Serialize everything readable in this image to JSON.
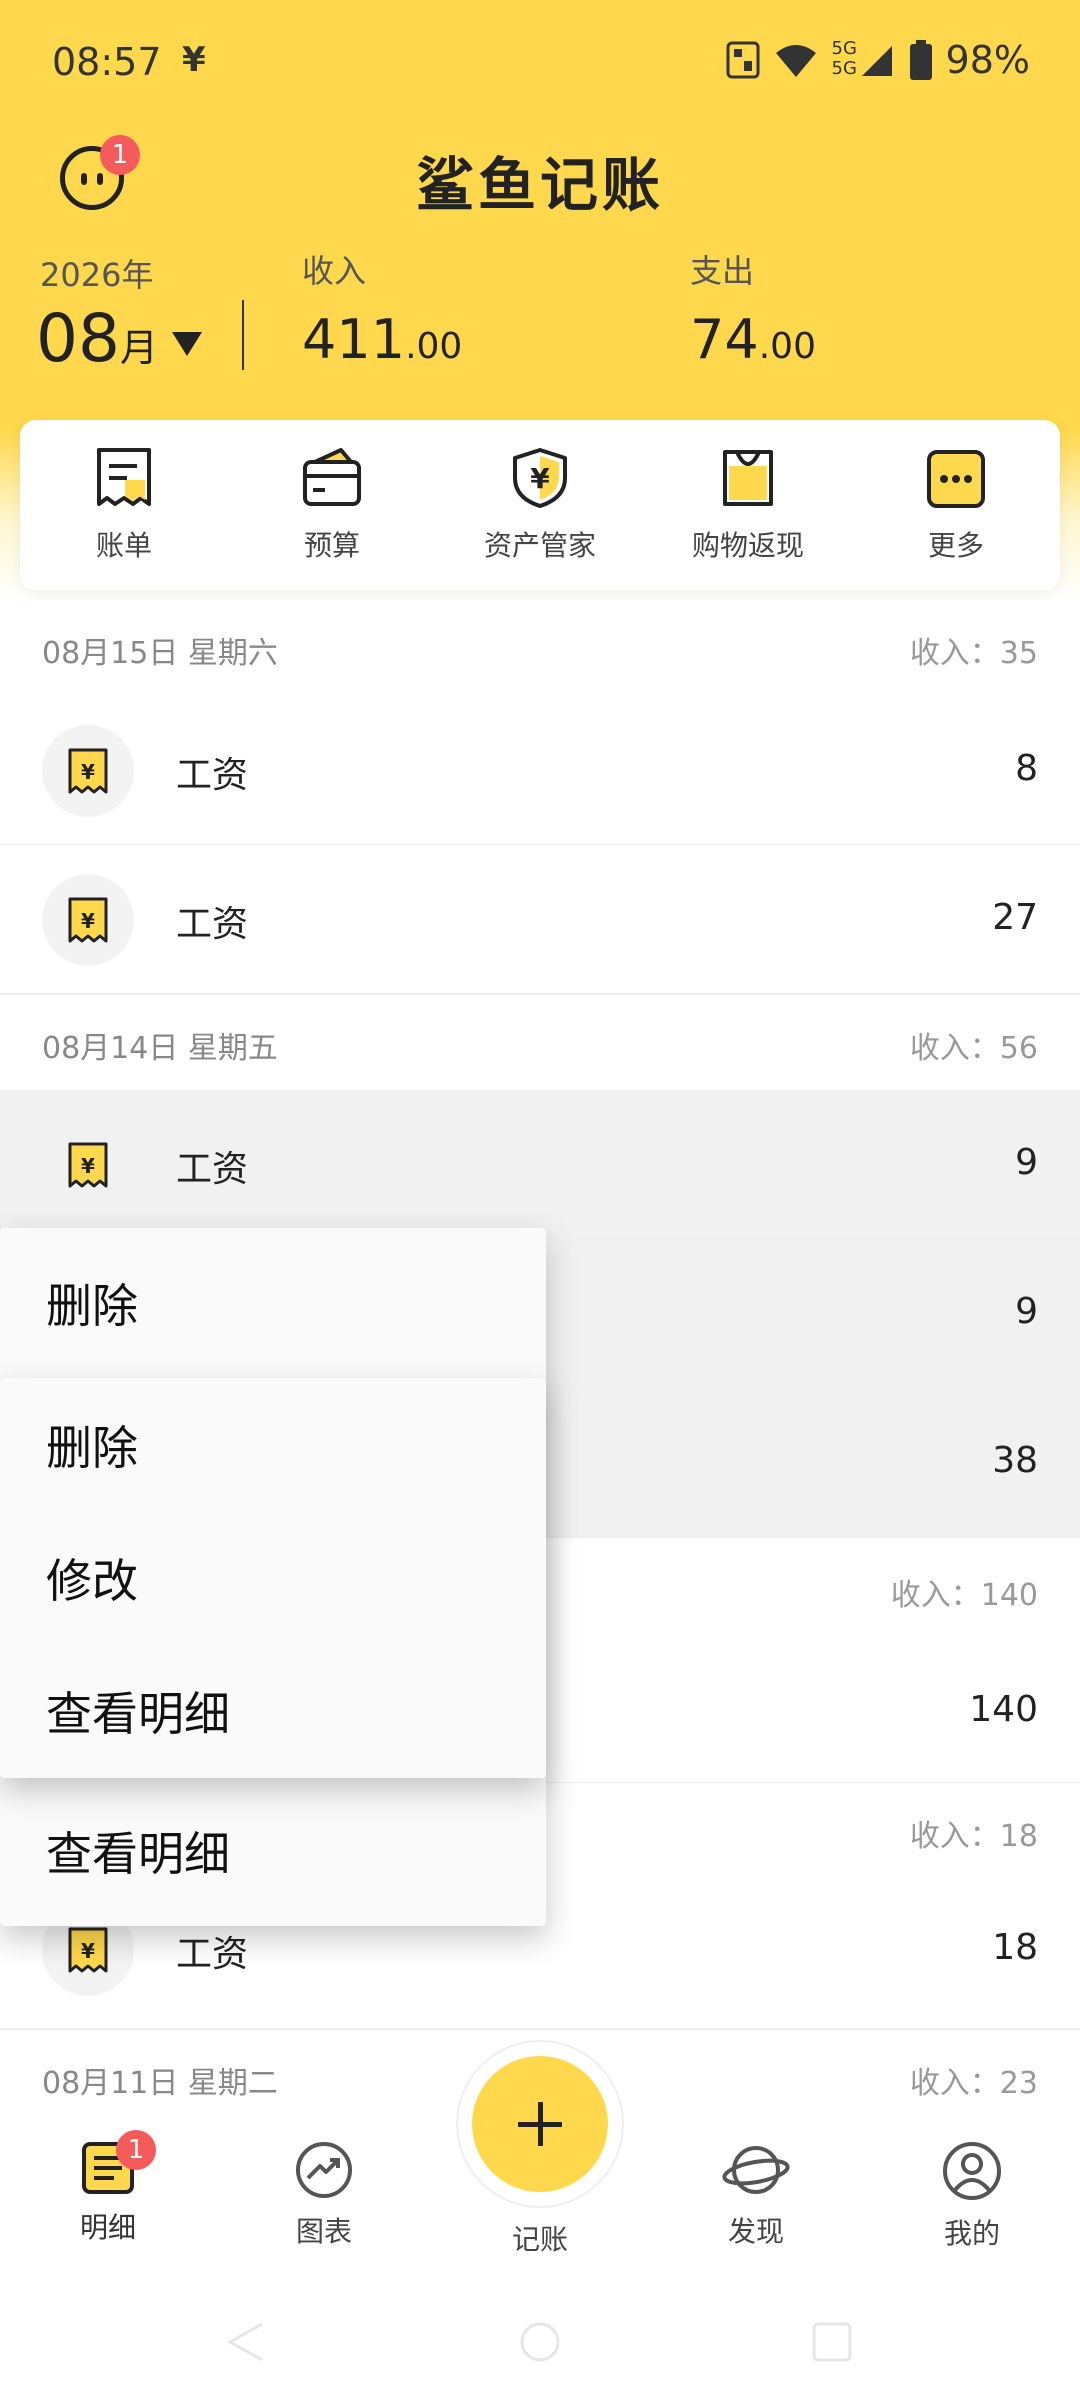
{
  "status": {
    "time": "08:57",
    "yen_glyph": "¥",
    "battery": "98%",
    "network_labels": [
      "5G",
      "5G"
    ]
  },
  "header": {
    "title": "鲨鱼记账",
    "avatar_badge": "1"
  },
  "summary": {
    "year": "2026年",
    "month": "08",
    "month_unit": "月",
    "income_label": "收入",
    "income_int": "411",
    "income_dec": ".00",
    "expense_label": "支出",
    "expense_int": "74",
    "expense_dec": ".00"
  },
  "quick_actions": [
    {
      "label": "账单",
      "icon": "bill-icon"
    },
    {
      "label": "预算",
      "icon": "wallet-icon"
    },
    {
      "label": "资产管家",
      "icon": "shield-yen-icon"
    },
    {
      "label": "购物返现",
      "icon": "shopping-bag-icon"
    },
    {
      "label": "更多",
      "icon": "more-icon"
    }
  ],
  "sections": [
    {
      "date": "08月15日 星期六",
      "summary": "收入：35",
      "rows": [
        {
          "label": "工资",
          "amount": "8"
        },
        {
          "label": "工资",
          "amount": "27"
        }
      ]
    },
    {
      "date": "08月14日 星期五",
      "summary": "收入：56",
      "rows": [
        {
          "label": "工资",
          "amount": "9"
        },
        {
          "label": "",
          "amount": "9"
        },
        {
          "label": "",
          "amount": "38"
        }
      ]
    },
    {
      "date": "",
      "summary": "收入：140",
      "rows": [
        {
          "label": "",
          "amount": "140"
        }
      ]
    },
    {
      "date": "",
      "summary": "收入：18",
      "rows": [
        {
          "label": "工资",
          "amount": "18"
        }
      ]
    },
    {
      "date": "08月11日 星期二",
      "summary": "收入：23",
      "rows": []
    }
  ],
  "context_menu_back": {
    "items": [
      "删除",
      "查看明细"
    ]
  },
  "context_menu_front": {
    "items": [
      "删除",
      "修改",
      "查看明细"
    ]
  },
  "bottom_nav": {
    "items": [
      {
        "label": "明细",
        "icon": "list-icon",
        "badge": "1"
      },
      {
        "label": "图表",
        "icon": "chart-icon"
      },
      {
        "label": "记账",
        "icon": "plus-icon"
      },
      {
        "label": "发现",
        "icon": "planet-icon"
      },
      {
        "label": "我的",
        "icon": "profile-icon"
      }
    ]
  },
  "colors": {
    "brand_yellow": "#ffd84d",
    "badge_red": "#f55b5b"
  }
}
